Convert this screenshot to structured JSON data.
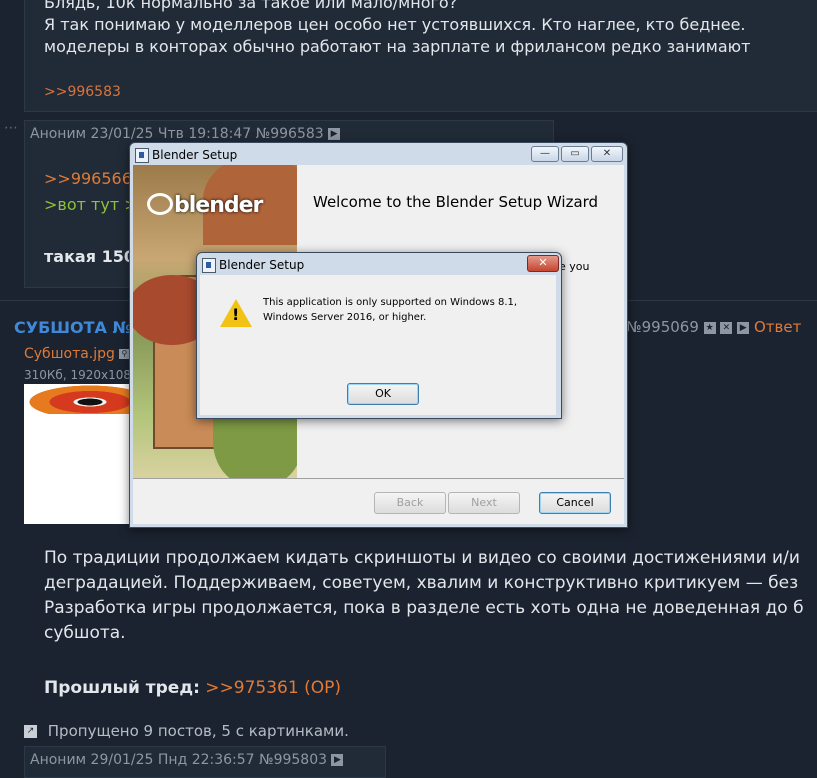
{
  "forum": {
    "top_post": {
      "line1": "Блядь, 10к нормально за такое или мало/много?",
      "line2": "Я так понимаю у моделлеров цен особо нет устоявшихся. Кто наглее, кто беднее.",
      "line3": "моделеры в конторах обычно работают на зарплате и фрилансом редко занимают",
      "reply_ref": ">>996583"
    },
    "second_post": {
      "header": "Аноним 23/01/25 Чтв 19:18:47 №996583",
      "reply_ref": ">>996566",
      "quote": ">вот тут >",
      "text": "такая 150"
    },
    "op_post": {
      "title": "СУБШОТА №",
      "number": "№995069",
      "reply_label": "Ответ",
      "file_name": "Субшота.jpg",
      "file_info": "310Кб, 1920х1080",
      "body_line1": "По традиции продолжаем кидать скриншоты и видео со своими достижениями и/и",
      "body_line2": "деградацией. Поддерживаем, советуем, хвалим и конструктивно критикуем — без",
      "body_line3": "Разработка игры продолжается, пока в разделе есть хоть одна не доведенная до б",
      "body_line4": "субшота.",
      "prev_label": "Прошлый тред:",
      "prev_link": ">>975361 (OP)"
    },
    "skipped": "Пропущено 9 постов, 5 с картинками.",
    "bottom_header": "Аноним 29/01/25 Пнд 22:36:57 №995803"
  },
  "setup_window": {
    "title": "Blender Setup",
    "logo": "blender",
    "welcome": "Welcome to the Blender Setup Wizard",
    "partial_text": "e you",
    "back_label": "Back",
    "next_label": "Next",
    "cancel_label": "Cancel"
  },
  "error_dialog": {
    "title": "Blender Setup",
    "message_line1": "This application is only supported on Windows 8.1,",
    "message_line2": "Windows Server 2016, or higher.",
    "ok_label": "OK",
    "icon": "warning-icon"
  },
  "colors": {
    "page_bg": "#1b2330",
    "link": "#d9743a",
    "quote": "#8fc03a",
    "title_blue": "#3f89d8"
  }
}
